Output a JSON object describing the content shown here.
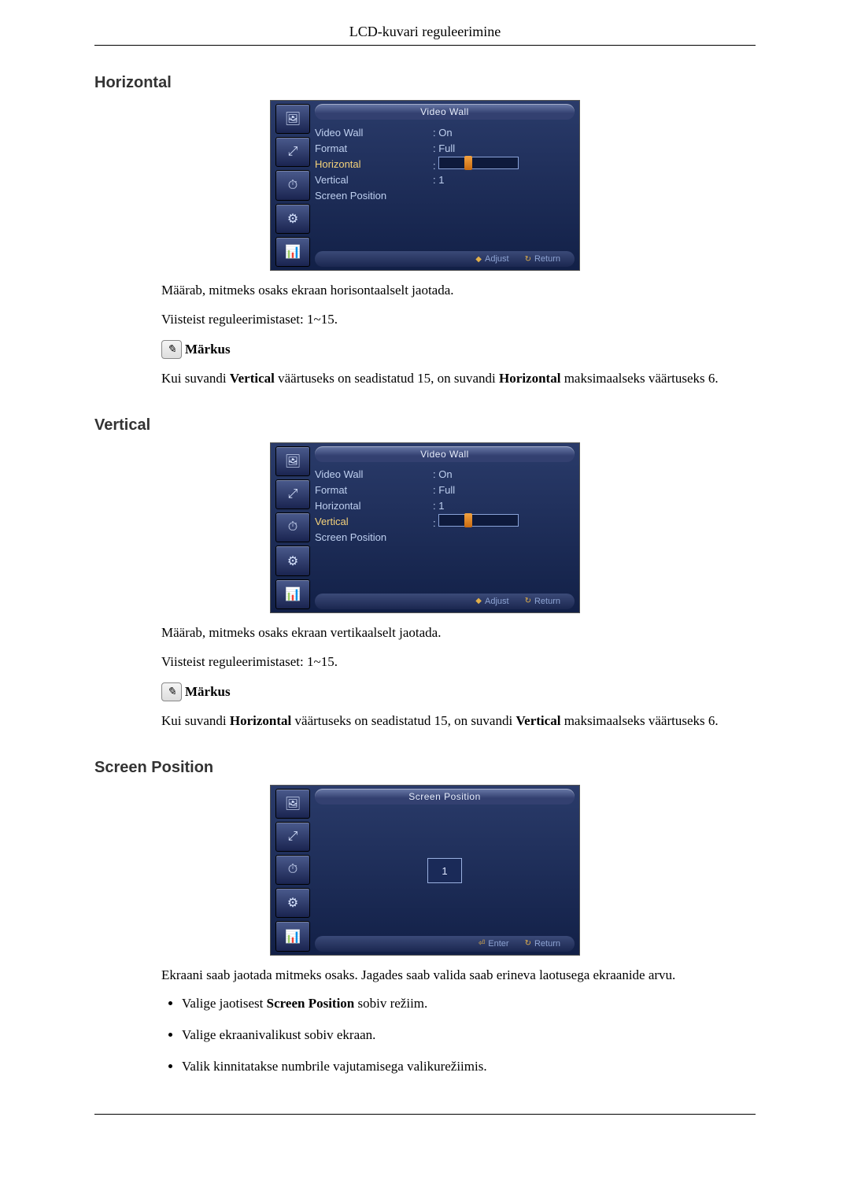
{
  "header": "LCD-kuvari reguleerimine",
  "sections": {
    "horizontal": {
      "title": "Horizontal",
      "osd_title": "Video Wall",
      "rows": [
        {
          "label": "Video Wall",
          "value": ": On"
        },
        {
          "label": "Format",
          "value": ": Full"
        },
        {
          "label": "Horizontal",
          "value": ":",
          "slider": true,
          "highlight": true
        },
        {
          "label": "Vertical",
          "value": ": 1"
        },
        {
          "label": "Screen Position",
          "value": ""
        }
      ],
      "footer": {
        "adjust": "Adjust",
        "return": "Return"
      },
      "desc1": "Määrab, mitmeks osaks ekraan horisontaalselt jaotada.",
      "desc2": "Viisteist reguleerimistaset: 1~15.",
      "note_label": "Märkus",
      "note_text_pre": "Kui suvandi ",
      "note_bold1": "Vertical",
      "note_text_mid": " väärtuseks on seadistatud 15, on suvandi ",
      "note_bold2": "Horizontal",
      "note_text_post": " maksimaalseks väärtuseks 6."
    },
    "vertical": {
      "title": "Vertical",
      "osd_title": "Video Wall",
      "rows": [
        {
          "label": "Video Wall",
          "value": ": On"
        },
        {
          "label": "Format",
          "value": ": Full"
        },
        {
          "label": "Horizontal",
          "value": ": 1"
        },
        {
          "label": "Vertical",
          "value": ":",
          "slider": true,
          "highlight": true
        },
        {
          "label": "Screen Position",
          "value": ""
        }
      ],
      "footer": {
        "adjust": "Adjust",
        "return": "Return"
      },
      "desc1": "Määrab, mitmeks osaks ekraan vertikaalselt jaotada.",
      "desc2": "Viisteist reguleerimistaset: 1~15.",
      "note_label": "Märkus",
      "note_text_pre": "Kui suvandi ",
      "note_bold1": "Horizontal",
      "note_text_mid": " väärtuseks on seadistatud 15, on suvandi ",
      "note_bold2": "Vertical",
      "note_text_post": " maksimaalseks väärtuseks 6."
    },
    "screen_position": {
      "title": "Screen Position",
      "osd_title": "Screen Position",
      "cell_value": "1",
      "footer": {
        "enter": "Enter",
        "return": "Return"
      },
      "desc1": "Ekraani saab jaotada mitmeks osaks. Jagades saab valida saab erineva laotusega ekraanide arvu.",
      "bullets": [
        {
          "pre": "Valige jaotisest ",
          "bold": "Screen Position",
          "post": " sobiv režiim."
        },
        {
          "pre": "Valige ekraanivalikust sobiv ekraan.",
          "bold": "",
          "post": ""
        },
        {
          "pre": "Valik kinnitatakse numbrile vajutamisega valikurežiimis.",
          "bold": "",
          "post": ""
        }
      ]
    }
  },
  "osd_tabs": [
    "🖼",
    "⤢",
    "⏱",
    "⚙",
    "📊"
  ]
}
